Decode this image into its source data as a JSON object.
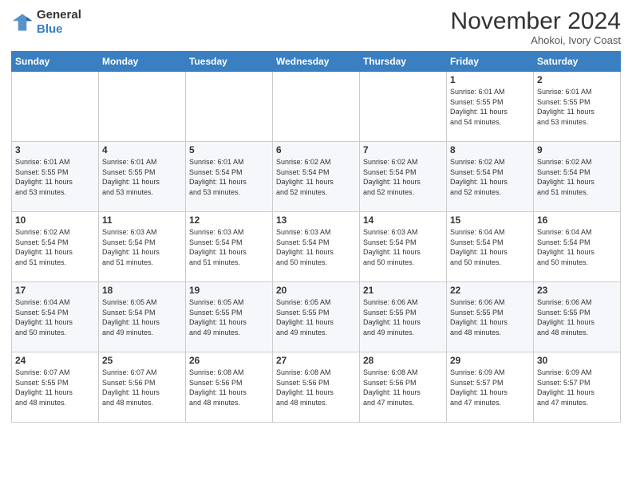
{
  "header": {
    "logo_line1": "General",
    "logo_line2": "Blue",
    "month_title": "November 2024",
    "location": "Ahokoi, Ivory Coast"
  },
  "weekdays": [
    "Sunday",
    "Monday",
    "Tuesday",
    "Wednesday",
    "Thursday",
    "Friday",
    "Saturday"
  ],
  "weeks": [
    [
      {
        "day": "",
        "info": ""
      },
      {
        "day": "",
        "info": ""
      },
      {
        "day": "",
        "info": ""
      },
      {
        "day": "",
        "info": ""
      },
      {
        "day": "",
        "info": ""
      },
      {
        "day": "1",
        "info": "Sunrise: 6:01 AM\nSunset: 5:55 PM\nDaylight: 11 hours\nand 54 minutes."
      },
      {
        "day": "2",
        "info": "Sunrise: 6:01 AM\nSunset: 5:55 PM\nDaylight: 11 hours\nand 53 minutes."
      }
    ],
    [
      {
        "day": "3",
        "info": "Sunrise: 6:01 AM\nSunset: 5:55 PM\nDaylight: 11 hours\nand 53 minutes."
      },
      {
        "day": "4",
        "info": "Sunrise: 6:01 AM\nSunset: 5:55 PM\nDaylight: 11 hours\nand 53 minutes."
      },
      {
        "day": "5",
        "info": "Sunrise: 6:01 AM\nSunset: 5:54 PM\nDaylight: 11 hours\nand 53 minutes."
      },
      {
        "day": "6",
        "info": "Sunrise: 6:02 AM\nSunset: 5:54 PM\nDaylight: 11 hours\nand 52 minutes."
      },
      {
        "day": "7",
        "info": "Sunrise: 6:02 AM\nSunset: 5:54 PM\nDaylight: 11 hours\nand 52 minutes."
      },
      {
        "day": "8",
        "info": "Sunrise: 6:02 AM\nSunset: 5:54 PM\nDaylight: 11 hours\nand 52 minutes."
      },
      {
        "day": "9",
        "info": "Sunrise: 6:02 AM\nSunset: 5:54 PM\nDaylight: 11 hours\nand 51 minutes."
      }
    ],
    [
      {
        "day": "10",
        "info": "Sunrise: 6:02 AM\nSunset: 5:54 PM\nDaylight: 11 hours\nand 51 minutes."
      },
      {
        "day": "11",
        "info": "Sunrise: 6:03 AM\nSunset: 5:54 PM\nDaylight: 11 hours\nand 51 minutes."
      },
      {
        "day": "12",
        "info": "Sunrise: 6:03 AM\nSunset: 5:54 PM\nDaylight: 11 hours\nand 51 minutes."
      },
      {
        "day": "13",
        "info": "Sunrise: 6:03 AM\nSunset: 5:54 PM\nDaylight: 11 hours\nand 50 minutes."
      },
      {
        "day": "14",
        "info": "Sunrise: 6:03 AM\nSunset: 5:54 PM\nDaylight: 11 hours\nand 50 minutes."
      },
      {
        "day": "15",
        "info": "Sunrise: 6:04 AM\nSunset: 5:54 PM\nDaylight: 11 hours\nand 50 minutes."
      },
      {
        "day": "16",
        "info": "Sunrise: 6:04 AM\nSunset: 5:54 PM\nDaylight: 11 hours\nand 50 minutes."
      }
    ],
    [
      {
        "day": "17",
        "info": "Sunrise: 6:04 AM\nSunset: 5:54 PM\nDaylight: 11 hours\nand 50 minutes."
      },
      {
        "day": "18",
        "info": "Sunrise: 6:05 AM\nSunset: 5:54 PM\nDaylight: 11 hours\nand 49 minutes."
      },
      {
        "day": "19",
        "info": "Sunrise: 6:05 AM\nSunset: 5:55 PM\nDaylight: 11 hours\nand 49 minutes."
      },
      {
        "day": "20",
        "info": "Sunrise: 6:05 AM\nSunset: 5:55 PM\nDaylight: 11 hours\nand 49 minutes."
      },
      {
        "day": "21",
        "info": "Sunrise: 6:06 AM\nSunset: 5:55 PM\nDaylight: 11 hours\nand 49 minutes."
      },
      {
        "day": "22",
        "info": "Sunrise: 6:06 AM\nSunset: 5:55 PM\nDaylight: 11 hours\nand 48 minutes."
      },
      {
        "day": "23",
        "info": "Sunrise: 6:06 AM\nSunset: 5:55 PM\nDaylight: 11 hours\nand 48 minutes."
      }
    ],
    [
      {
        "day": "24",
        "info": "Sunrise: 6:07 AM\nSunset: 5:55 PM\nDaylight: 11 hours\nand 48 minutes."
      },
      {
        "day": "25",
        "info": "Sunrise: 6:07 AM\nSunset: 5:56 PM\nDaylight: 11 hours\nand 48 minutes."
      },
      {
        "day": "26",
        "info": "Sunrise: 6:08 AM\nSunset: 5:56 PM\nDaylight: 11 hours\nand 48 minutes."
      },
      {
        "day": "27",
        "info": "Sunrise: 6:08 AM\nSunset: 5:56 PM\nDaylight: 11 hours\nand 48 minutes."
      },
      {
        "day": "28",
        "info": "Sunrise: 6:08 AM\nSunset: 5:56 PM\nDaylight: 11 hours\nand 47 minutes."
      },
      {
        "day": "29",
        "info": "Sunrise: 6:09 AM\nSunset: 5:57 PM\nDaylight: 11 hours\nand 47 minutes."
      },
      {
        "day": "30",
        "info": "Sunrise: 6:09 AM\nSunset: 5:57 PM\nDaylight: 11 hours\nand 47 minutes."
      }
    ]
  ]
}
